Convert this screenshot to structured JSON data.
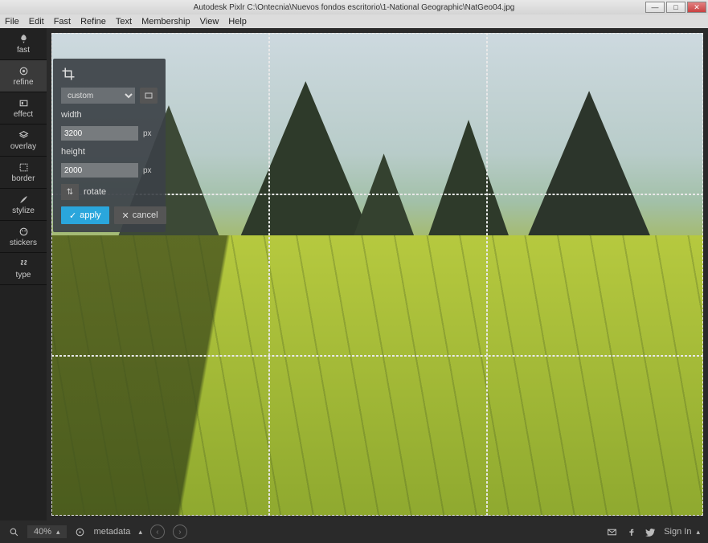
{
  "window": {
    "title": "Autodesk Pixlr   C:\\Ontecnia\\Nuevos fondos escritorio\\1-National Geographic\\NatGeo04.jpg"
  },
  "menu": {
    "items": [
      "File",
      "Edit",
      "Fast",
      "Refine",
      "Text",
      "Membership",
      "View",
      "Help"
    ]
  },
  "tools": {
    "items": [
      {
        "id": "fast",
        "label": "fast"
      },
      {
        "id": "refine",
        "label": "refine"
      },
      {
        "id": "effect",
        "label": "effect"
      },
      {
        "id": "overlay",
        "label": "overlay"
      },
      {
        "id": "border",
        "label": "border"
      },
      {
        "id": "stylize",
        "label": "stylize"
      },
      {
        "id": "stickers",
        "label": "stickers"
      },
      {
        "id": "type",
        "label": "type"
      }
    ],
    "active": "refine"
  },
  "crop_panel": {
    "mode": "custom",
    "width_label": "width",
    "width_value": "3200",
    "height_label": "height",
    "height_value": "2000",
    "unit": "px",
    "rotate_label": "rotate",
    "apply_label": "apply",
    "cancel_label": "cancel"
  },
  "bottom": {
    "zoom": "40%",
    "metadata": "metadata",
    "sign_in": "Sign In"
  }
}
